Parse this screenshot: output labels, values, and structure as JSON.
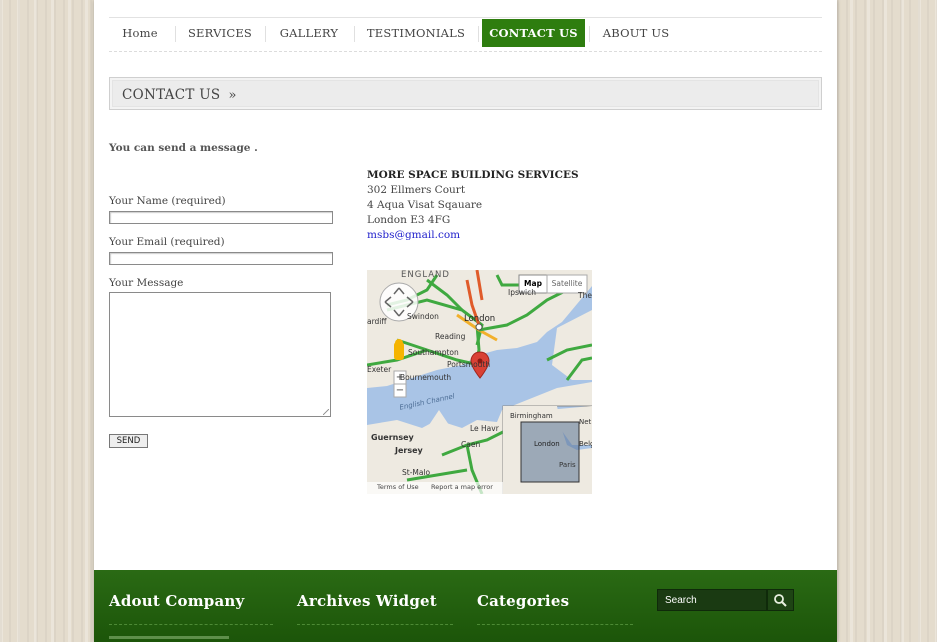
{
  "nav": {
    "items": [
      {
        "label": "Home"
      },
      {
        "label": "SERVICES"
      },
      {
        "label": "GALLERY"
      },
      {
        "label": "TESTIMONIALS"
      },
      {
        "label": "CONTACT US"
      },
      {
        "label": "ABOUT US"
      }
    ],
    "active_index": 4
  },
  "page_title": "CONTACT US",
  "page_title_arrow": "»",
  "intro": "You can send a message .",
  "form": {
    "name_label": "Your Name (required)",
    "email_label": "Your Email (required)",
    "message_label": "Your Message",
    "name_value": "",
    "email_value": "",
    "message_value": "",
    "send_label": "SEND"
  },
  "address": {
    "company": "MORE SPACE BUILDING SERVICES",
    "line1": "302 Ellmers Court",
    "line2": "4 Aqua Visat Sqauare",
    "line3": "London E3 4FG",
    "email": "msbs@gmail.com"
  },
  "map": {
    "type_map": "Map",
    "type_satellite": "Satellite",
    "zoom_in": "+",
    "zoom_out": "−",
    "labels": {
      "england": "ENGLAND",
      "ipswich": "Ipswich",
      "cardiff": "ardiff",
      "swindon": "Swindon",
      "london": "London",
      "reading": "Reading",
      "southampton": "Southampton",
      "portsmouth": "Portsmouth",
      "exeter": "Exeter",
      "bournemouth": "Bournemouth",
      "channel": "English Channel",
      "guernsey": "Guernsey",
      "jersey": "Jersey",
      "lehavre": "Le Havr",
      "caen": "Caen",
      "stmalo": "St-Malo",
      "the": "The",
      "birmingham": "Birmingham",
      "mini_london": "London",
      "net": "Net",
      "belgi": "Belgi",
      "paris": "Paris",
      "terms": "Terms of Use",
      "report": "Report a map error"
    }
  },
  "footer": {
    "col1_title": "Adout Company",
    "col2_title": "Archives Widget",
    "col3_title": "Categories",
    "search_placeholder": "Search"
  },
  "colors": {
    "accent_green": "#2e7d0f",
    "footer_green": "#1c5509",
    "link_blue": "#2222cc"
  }
}
